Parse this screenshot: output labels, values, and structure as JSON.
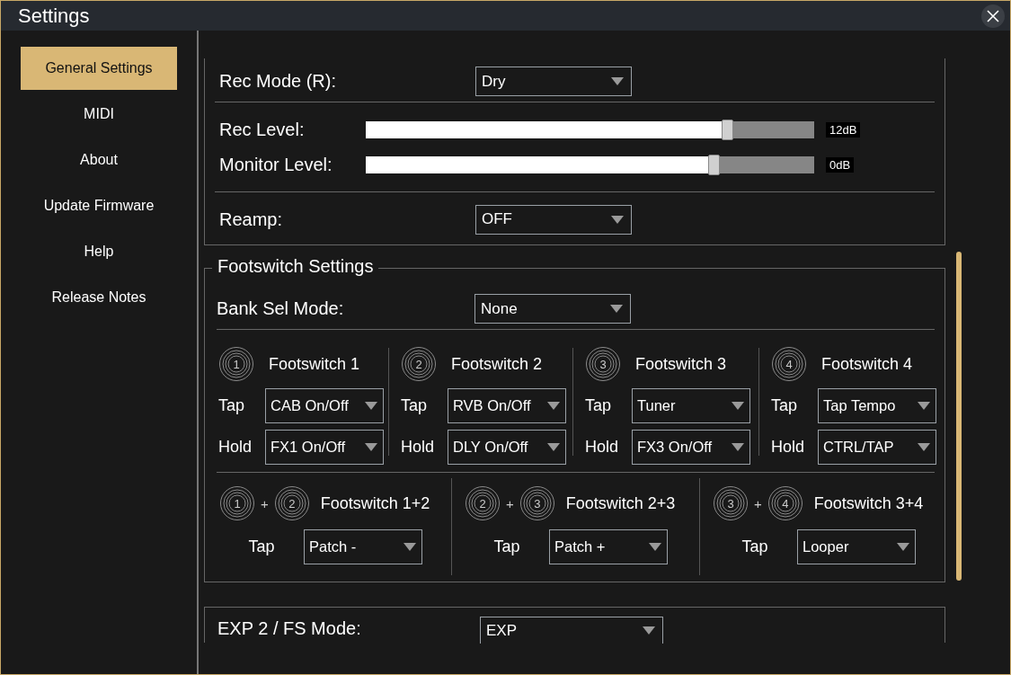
{
  "window": {
    "title": "Settings"
  },
  "sidebar": {
    "items": [
      {
        "label": "General Settings",
        "selected": true
      },
      {
        "label": "MIDI",
        "selected": false
      },
      {
        "label": "About",
        "selected": false
      },
      {
        "label": "Update Firmware",
        "selected": false
      },
      {
        "label": "Help",
        "selected": false
      },
      {
        "label": "Release Notes",
        "selected": false
      }
    ]
  },
  "recording": {
    "rec_mode": {
      "label": "Rec Mode (R):",
      "value": "Dry"
    },
    "sliders": [
      {
        "label": "Rec Level:",
        "level": 0.81,
        "reading": "12dB"
      },
      {
        "label": "Monitor Level:",
        "level": 0.78,
        "reading": "0dB"
      }
    ],
    "reamp": {
      "label": "Reamp:",
      "value": "OFF"
    }
  },
  "footswitch_settings": {
    "title": "Footswitch Settings",
    "bank_sel_mode": {
      "label": "Bank Sel Mode:",
      "value": "None"
    },
    "switches": [
      {
        "number": "1",
        "title": "Footswitch 1",
        "tap": {
          "label": "Tap",
          "value": "CAB On/Off"
        },
        "hold": {
          "label": "Hold",
          "value": "FX1 On/Off"
        }
      },
      {
        "number": "2",
        "title": "Footswitch 2",
        "tap": {
          "label": "Tap",
          "value": "RVB On/Off"
        },
        "hold": {
          "label": "Hold",
          "value": "DLY On/Off"
        }
      },
      {
        "number": "3",
        "title": "Footswitch 3",
        "tap": {
          "label": "Tap",
          "value": "Tuner"
        },
        "hold": {
          "label": "Hold",
          "value": "FX3 On/Off"
        }
      },
      {
        "number": "4",
        "title": "Footswitch 4",
        "tap": {
          "label": "Tap",
          "value": "Tap Tempo"
        },
        "hold": {
          "label": "Hold",
          "value": "CTRL/TAP"
        }
      }
    ],
    "combos": [
      {
        "numbers": [
          "1",
          "2"
        ],
        "plus": "+",
        "title": "Footswitch 1+2",
        "tap": {
          "label": "Tap",
          "value": "Patch -"
        }
      },
      {
        "numbers": [
          "2",
          "3"
        ],
        "plus": "+",
        "title": "Footswitch 2+3",
        "tap": {
          "label": "Tap",
          "value": "Patch +"
        }
      },
      {
        "numbers": [
          "3",
          "4"
        ],
        "plus": "+",
        "title": "Footswitch 3+4",
        "tap": {
          "label": "Tap",
          "value": "Looper"
        }
      }
    ]
  },
  "exp": {
    "label": "EXP 2 / FS Mode:",
    "value": "EXP"
  }
}
